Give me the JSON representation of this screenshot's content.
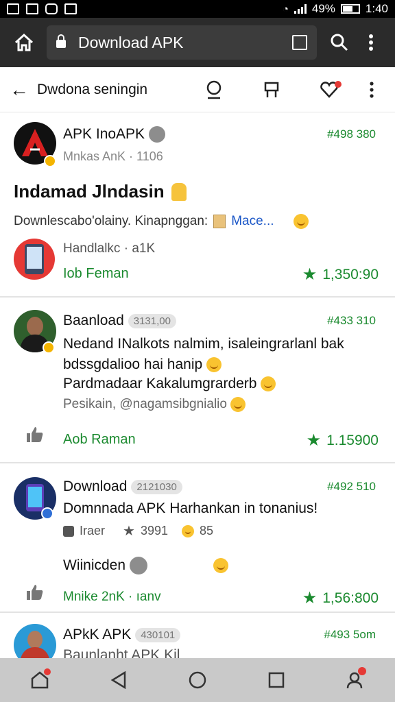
{
  "status_bar": {
    "battery": "49%",
    "time": "1:40"
  },
  "browser": {
    "url_text": "Download APK"
  },
  "app_bar": {
    "title": "Dwdona seningin"
  },
  "posts": [
    {
      "author": "APK InoAPK",
      "subtitle": "Mnkas AnK · 1106",
      "rank": "#498 380",
      "headline": "Indamad Jlndasin",
      "desc": "Downlescabo'olainy. Kinapnggan:",
      "link_text": "Mace...",
      "app_name": "Handlalkc · a1K",
      "action_label": "Iob Feman",
      "stars": "1,350:90"
    },
    {
      "author": "Baanload",
      "tag": "3131,00",
      "rank": "#433 310",
      "lines": [
        "Nedand INalkots nalmim, isaleingrarlanl bak",
        "bdssgdalioo hai hanip",
        "Pardmadaar Kakalumgrarderb",
        "Pesikain, @nagamsibgnialio"
      ],
      "action_label": "Aob Raman",
      "stars": "1.15900"
    },
    {
      "author": "Download",
      "tag": "2121030",
      "rank": "#492 510",
      "line": "Domnnada APK Harhankan in tonanius!",
      "meta_a": "Iraer",
      "meta_b": "3991",
      "meta_c": "85",
      "second_title": "Wiinicden",
      "action_label": "Mnike 2nK · ıanv",
      "stars": "1,56:800"
    },
    {
      "author": "APkK APK",
      "tag": "430101",
      "rank": "#493 5om",
      "line": "Baunlanht APK Kil"
    }
  ],
  "colors": {
    "green": "#1b8a2f",
    "top_bar": "#2b2b2b",
    "nav_bar": "#c9c9c9"
  }
}
